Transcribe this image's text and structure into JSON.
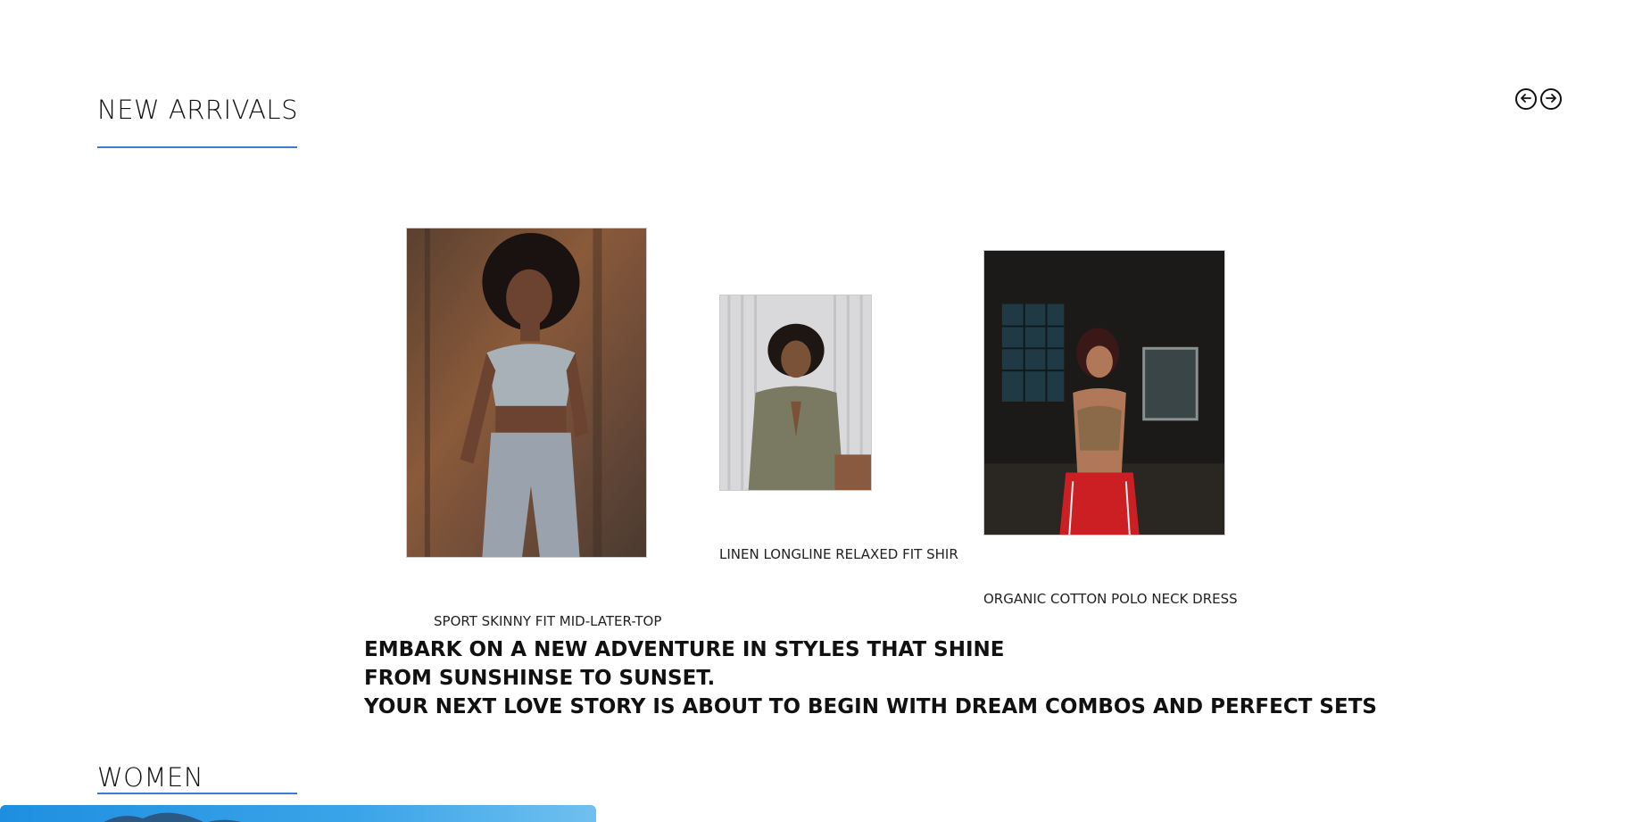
{
  "new_arrivals": {
    "title": "NEW ARRIVALS",
    "prev_icon": "arrow-left-circle-icon",
    "next_icon": "arrow-right-circle-icon"
  },
  "products": [
    {
      "name": "SPORT SKINNY FIT MID-LATER-TOP",
      "image": "woman-in-grey-sport-set-photo"
    },
    {
      "name": "LINEN LONGLINE RELAXED FIT SHIR",
      "image": "woman-meditating-in-olive-tee-photo"
    },
    {
      "name": "ORGANIC COTTON POLO NECK DRESS",
      "image": "woman-in-brown-top-and-red-pants-photo"
    }
  ],
  "tagline": {
    "line1": "EMBARK ON A NEW ADVENTURE IN STYLES THAT SHINE",
    "line2": "FROM SUNSHINSE TO SUNSET.",
    "line3": "YOUR NEXT LOVE STORY IS ABOUT TO BEGIN WITH DREAM COMBOS AND PERFECT SETS"
  },
  "women": {
    "title": "WOMEN",
    "banner": "women-category-banner-photo"
  },
  "colors": {
    "accent": "#3a7bd5",
    "text": "#111111",
    "background": "#ffffff"
  }
}
